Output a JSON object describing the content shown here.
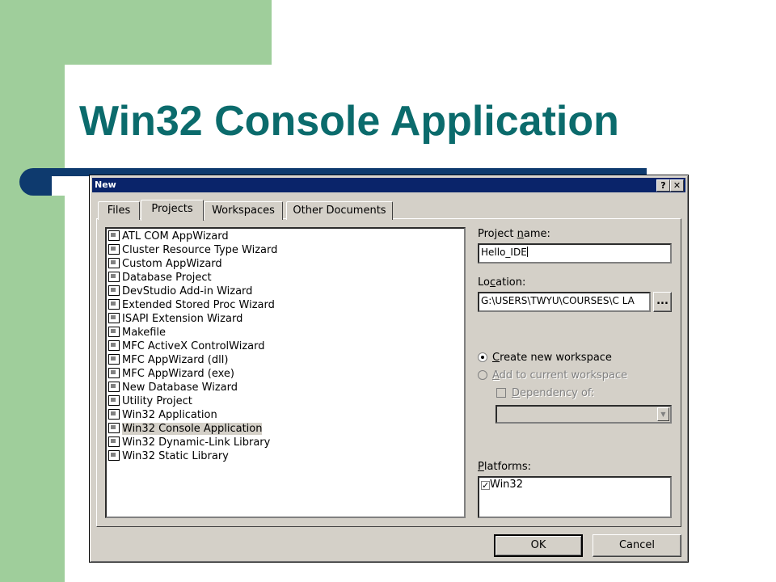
{
  "slide": {
    "title": "Win32 Console Application"
  },
  "dialog": {
    "title": "New",
    "help_btn": "?",
    "close_btn": "✕",
    "tabs": [
      "Files",
      "Projects",
      "Workspaces",
      "Other Documents"
    ],
    "project_types": [
      "ATL COM AppWizard",
      "Cluster Resource Type Wizard",
      "Custom AppWizard",
      "Database Project",
      "DevStudio Add-in Wizard",
      "Extended Stored Proc Wizard",
      "ISAPI Extension Wizard",
      "Makefile",
      "MFC ActiveX ControlWizard",
      "MFC AppWizard (dll)",
      "MFC AppWizard (exe)",
      "New Database Wizard",
      "Utility Project",
      "Win32 Application",
      "Win32 Console Application",
      "Win32 Dynamic-Link Library",
      "Win32 Static Library"
    ],
    "selected_project": "Win32 Console Application",
    "project_name_label_pre": "Project ",
    "project_name_label_ul": "n",
    "project_name_label_post": "ame:",
    "project_name_value": "Hello_IDE",
    "location_label_pre": "Lo",
    "location_label_ul": "c",
    "location_label_post": "ation:",
    "location_value": "G:\\USERS\\TWYU\\COURSES\\C LA",
    "browse_btn": "...",
    "create_ws_ul": "C",
    "create_ws_rest": "reate new workspace",
    "add_ws_ul": "A",
    "add_ws_rest": "dd to current workspace",
    "dependency_ul": "D",
    "dependency_rest": "ependency of:",
    "platforms_label_ul": "P",
    "platforms_label_rest": "latforms:",
    "platforms": [
      "Win32"
    ],
    "ok_btn": "OK",
    "cancel_btn": "Cancel"
  },
  "colors": {
    "title": "#0b6b6c",
    "green": "#9fce9b",
    "navy": "#0e3a6e",
    "titlebar": "#0a246a"
  }
}
